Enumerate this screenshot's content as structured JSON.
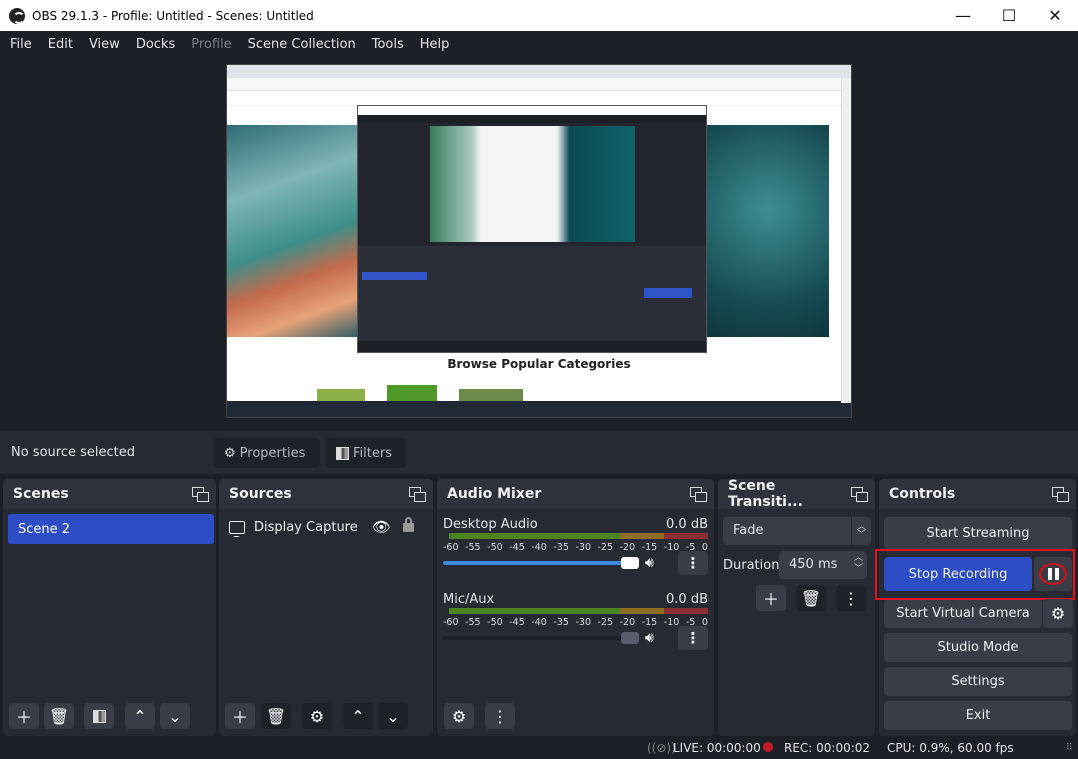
{
  "window": {
    "title": "OBS 29.1.3 - Profile: Untitled - Scenes: Untitled",
    "controls": {
      "minimize": "—",
      "maximize": "☐",
      "close": "✕"
    }
  },
  "menu": [
    {
      "label": "File",
      "enabled": true
    },
    {
      "label": "Edit",
      "enabled": true
    },
    {
      "label": "View",
      "enabled": true
    },
    {
      "label": "Docks",
      "enabled": true
    },
    {
      "label": "Profile",
      "enabled": false
    },
    {
      "label": "Scene Collection",
      "enabled": true
    },
    {
      "label": "Tools",
      "enabled": true
    },
    {
      "label": "Help",
      "enabled": true
    }
  ],
  "preview": {
    "heading": "Browse Popular Categories"
  },
  "context_bar": {
    "status": "No source selected",
    "properties_label": "Properties",
    "filters_label": "Filters"
  },
  "scenes": {
    "title": "Scenes",
    "items": [
      {
        "label": "Scene 2",
        "selected": true
      }
    ],
    "toolbar": [
      "add",
      "remove",
      "filters",
      "move-up",
      "move-down"
    ]
  },
  "sources": {
    "title": "Sources",
    "items": [
      {
        "label": "Display Capture",
        "visible": true,
        "locked": false
      }
    ],
    "toolbar": [
      "add",
      "remove",
      "properties",
      "move-up",
      "move-down"
    ]
  },
  "audio_mixer": {
    "title": "Audio Mixer",
    "scale": [
      "-60",
      "-55",
      "-50",
      "-45",
      "-40",
      "-35",
      "-30",
      "-25",
      "-20",
      "-15",
      "-10",
      "-5",
      "0"
    ],
    "channels": [
      {
        "name": "Desktop Audio",
        "level": "0.0 dB",
        "volume_fraction": 1.0
      },
      {
        "name": "Mic/Aux",
        "level": "0.0 dB",
        "volume_fraction": 1.0
      }
    ]
  },
  "transitions": {
    "title": "Scene Transiti...",
    "selected": "Fade",
    "duration_label": "Duration",
    "duration_value": "450 ms"
  },
  "controls": {
    "title": "Controls",
    "start_streaming": "Start Streaming",
    "stop_recording": "Stop Recording",
    "start_virtual_camera": "Start Virtual Camera",
    "studio_mode": "Studio Mode",
    "settings": "Settings",
    "exit": "Exit",
    "highlight_color": "#e0121b"
  },
  "status": {
    "live": "LIVE: 00:00:00",
    "rec": "REC: 00:00:02",
    "cpu": "CPU: 0.9%, 60.00 fps"
  },
  "colors": {
    "accent": "#2d4dc4",
    "background": "#1d1f26",
    "dock": "#272a33",
    "rec_dot": "#c41a28"
  }
}
